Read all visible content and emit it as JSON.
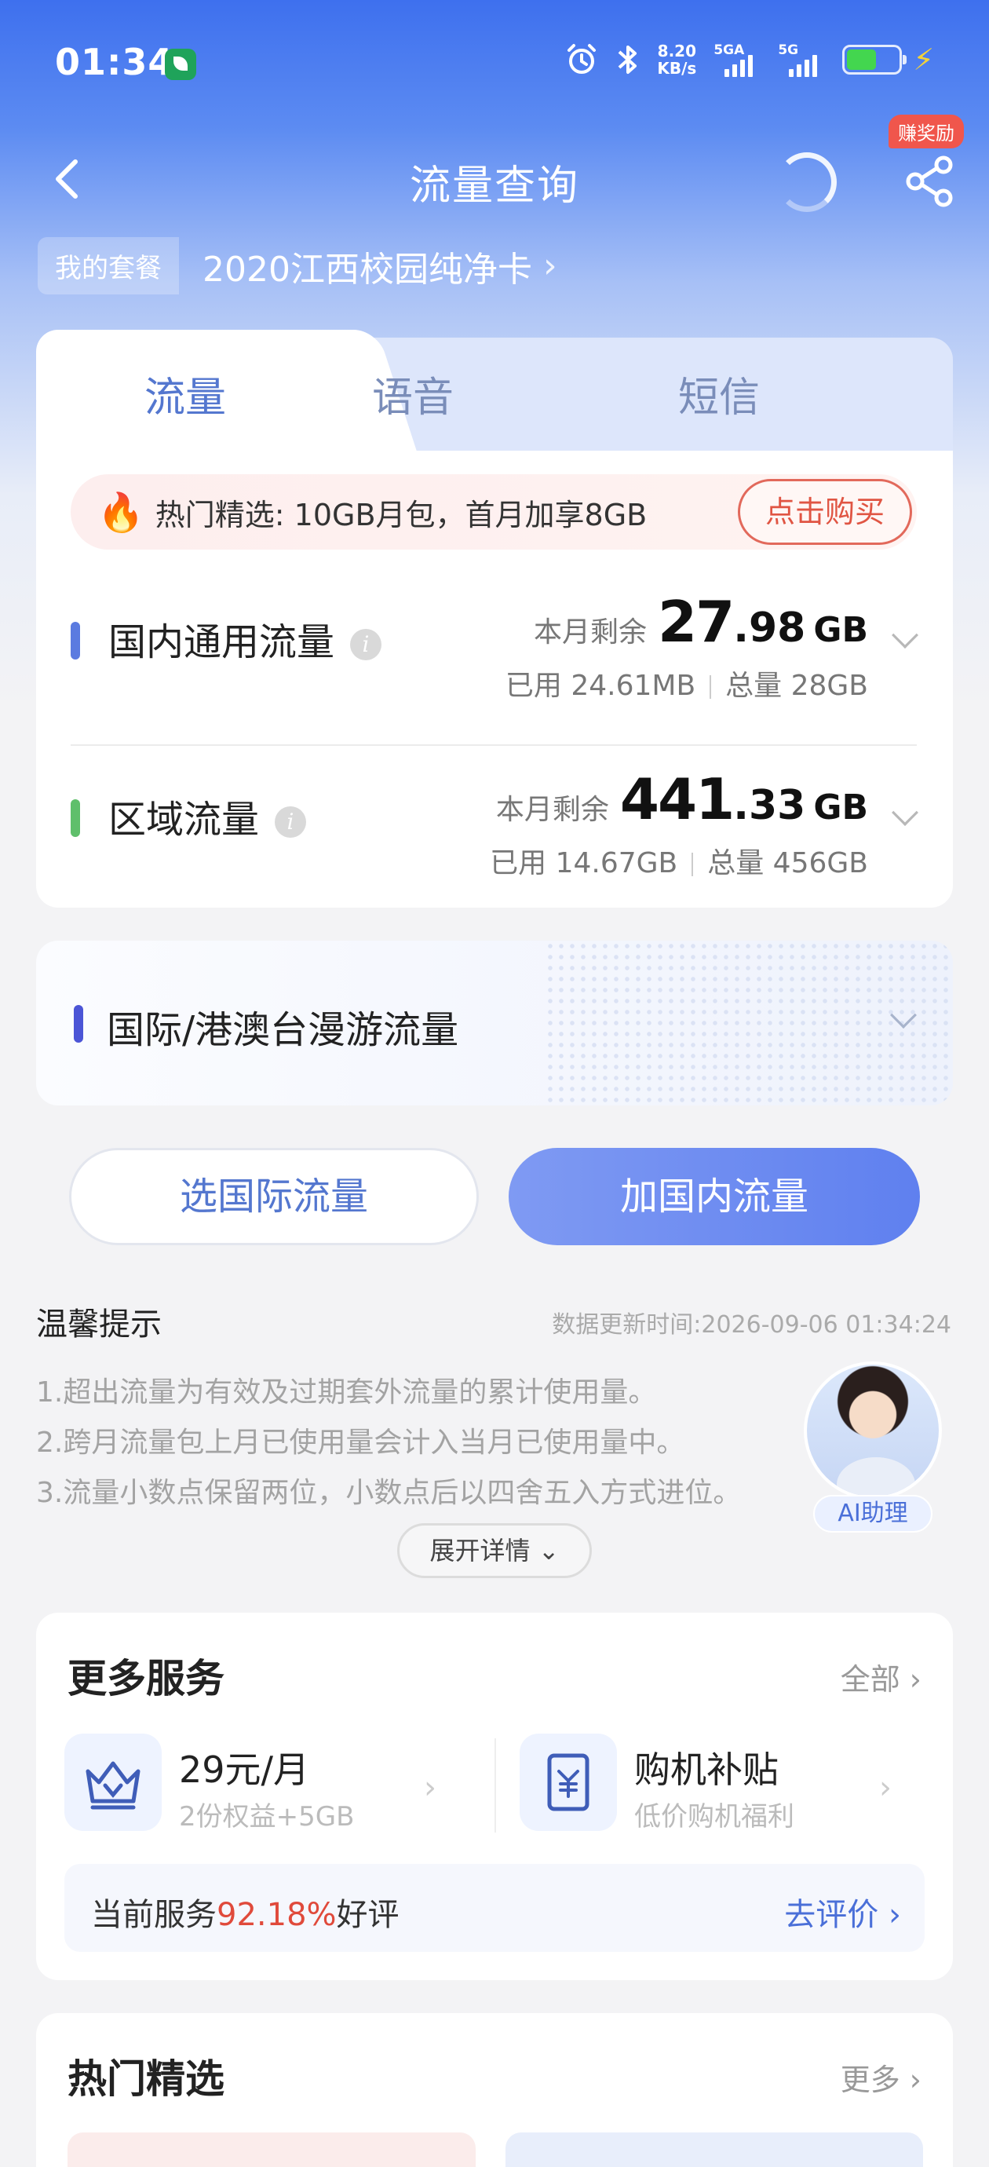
{
  "status_bar": {
    "time": "01:34",
    "speed_value": "8.20",
    "speed_unit": "KB/s",
    "net1": "5GA",
    "net2": "5G",
    "icons": [
      "wechat-app-icon",
      "alarm-icon",
      "bluetooth-icon",
      "signal-icon",
      "battery-icon",
      "charging-icon"
    ]
  },
  "nav": {
    "title": "流量查询",
    "reward_badge": "赚奖励"
  },
  "plan": {
    "tag": "我的套餐",
    "name": "2020江西校园纯净卡"
  },
  "tabs": [
    "流量",
    "语音",
    "短信"
  ],
  "promo": {
    "text": "热门精选: 10GB月包，首月加享8GB",
    "button": "点击购买"
  },
  "rows": [
    {
      "label": "国内通用流量",
      "bar_color": "#5b7be0",
      "remain_label": "本月剩余",
      "remain_int": "27",
      "remain_dec": ".98",
      "unit": "GB",
      "used": "已用 24.61MB",
      "total": "总量 28GB"
    },
    {
      "label": "区域流量",
      "bar_color": "#5fbf6b",
      "remain_label": "本月剩余",
      "remain_int": "441",
      "remain_dec": ".33",
      "unit": "GB",
      "used": "已用 14.67GB",
      "total": "总量 456GB"
    }
  ],
  "roaming": {
    "label": "国际/港澳台漫游流量"
  },
  "buttons": {
    "intl": "选国际流量",
    "domestic": "加国内流量"
  },
  "tips": {
    "title": "温馨提示",
    "update_time": "数据更新时间:2026-09-06 01:34:24",
    "lines": [
      "1.超出流量为有效及过期套外流量的累计使用量。",
      "2.跨月流量包上月已使用量会计入当月已使用量中。",
      "3.流量小数点保留两位，小数点后以四舍五入方式进位。"
    ],
    "ai_label": "AI助理",
    "expand": "展开详情"
  },
  "services": {
    "title": "更多服务",
    "all": "全部",
    "items": [
      {
        "name": "29元/月",
        "desc": "2份权益+5GB",
        "icon": "crown-v-icon"
      },
      {
        "name": "购机补贴",
        "desc": "低价购机福利",
        "icon": "yen-receipt-icon"
      }
    ],
    "rating_prefix": "当前服务",
    "rating_pct": "92.18%",
    "rating_suffix": "好评",
    "rating_link": "去评价"
  },
  "hot": {
    "title": "热门精选",
    "more": "更多"
  }
}
